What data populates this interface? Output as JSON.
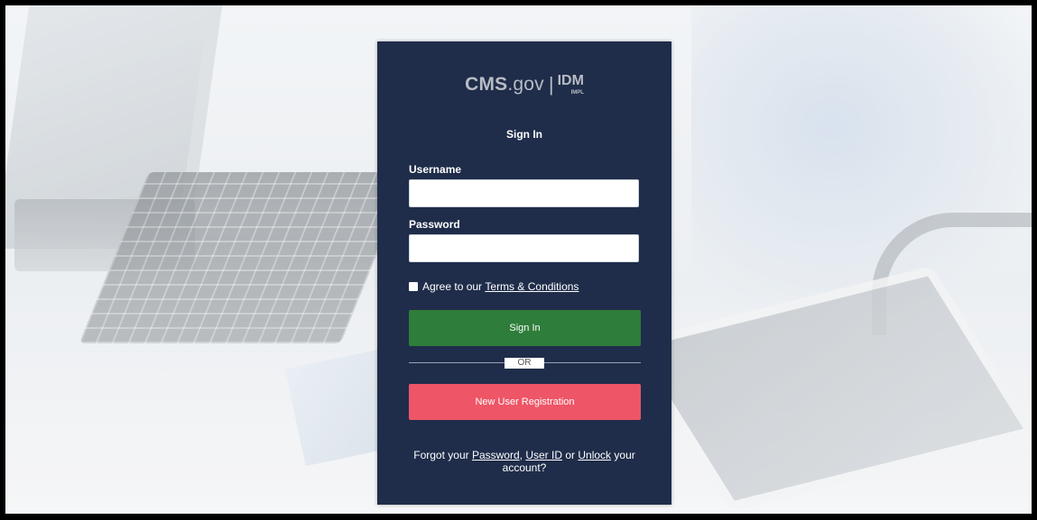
{
  "logo": {
    "brand": "CMS",
    "brand_suffix": ".gov",
    "separator": "|",
    "product": "IDM",
    "environment": "IMPL"
  },
  "login": {
    "title": "Sign In",
    "username_label": "Username",
    "username_value": "",
    "password_label": "Password",
    "password_value": "",
    "agree_text": "Agree to our",
    "terms_link": "Terms & Conditions",
    "signin_button": "Sign In",
    "or_text": "OR",
    "register_button": "New User Registration",
    "forgot_prefix": "Forgot your",
    "forgot_password": "Password",
    "forgot_comma": ",",
    "forgot_userid": "User ID",
    "forgot_or": "or",
    "forgot_unlock": "Unlock",
    "forgot_suffix": "your account?"
  },
  "colors": {
    "card_bg": "#1f2d4a",
    "signin_button": "#2e7d3a",
    "register_button": "#ee5566"
  }
}
